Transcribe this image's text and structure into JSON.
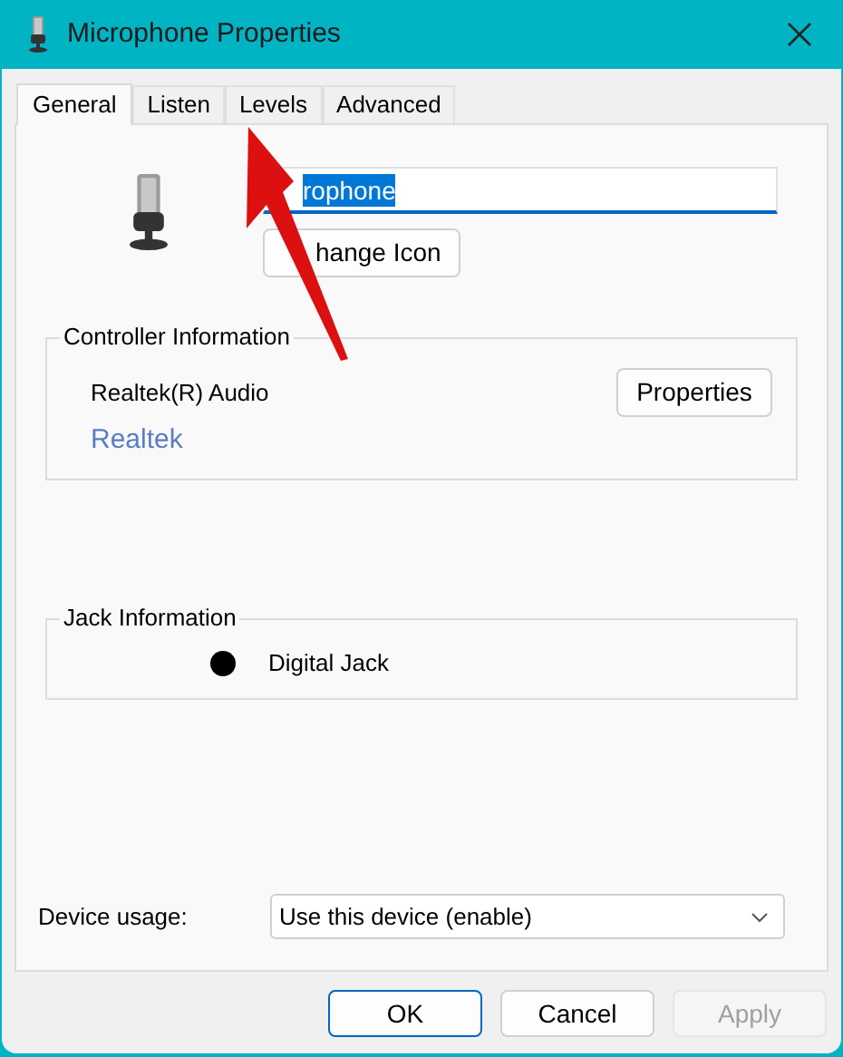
{
  "window": {
    "title": "Microphone Properties"
  },
  "tabs": [
    {
      "label": "General",
      "selected": true
    },
    {
      "label": "Listen",
      "selected": false
    },
    {
      "label": "Levels",
      "selected": false
    },
    {
      "label": "Advanced",
      "selected": false
    }
  ],
  "name_field": {
    "value": "rophone",
    "selected": true
  },
  "change_icon_button": "hange Icon",
  "controller": {
    "heading": "Controller Information",
    "name": "Realtek(R) Audio",
    "button": "Properties",
    "link": "Realtek"
  },
  "jack": {
    "heading": "Jack Information",
    "items": [
      {
        "label": "Digital Jack",
        "color": "#000000"
      }
    ]
  },
  "device_usage": {
    "label": "Device usage:",
    "value": "Use this device (enable)"
  },
  "buttons": [
    {
      "label": "OK",
      "kind": "default",
      "disabled": false
    },
    {
      "label": "Cancel",
      "kind": "normal",
      "disabled": false
    },
    {
      "label": "Apply",
      "kind": "normal",
      "disabled": true
    }
  ]
}
